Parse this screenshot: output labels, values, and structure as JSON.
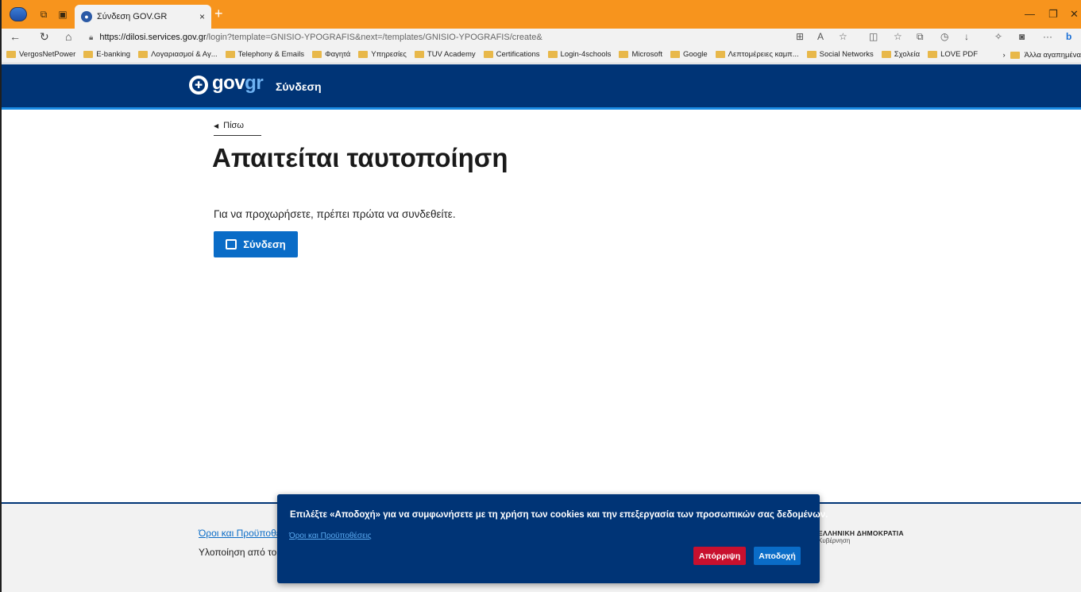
{
  "browser": {
    "tab_title": "Σύνδεση GOV.GR",
    "tab_close": "×",
    "new_tab": "+",
    "url_host": "https://dilosi.services.gov.gr",
    "url_path": "/login?template=GNISIO-YPOGRAFIS&next=/templates/GNISIO-YPOGRAFIS/create&",
    "bookmarks": [
      "VergosNetPower",
      "E-banking",
      "Λογαριασμοί & Αγ...",
      "Telephony & Emails",
      "Φαγητά",
      "Υπηρεσίες",
      "TUV Academy",
      "Certifications",
      "Login-4schools",
      "Microsoft",
      "Google",
      "Λεπτομέρειες καμπ...",
      "Social Networks",
      "Σχολεία",
      "LOVE PDF"
    ],
    "other_bookmarks": "Άλλα αγαπημένα"
  },
  "header": {
    "logo_gov": "gov",
    "logo_gr": "gr",
    "service_name": "Σύνδεση"
  },
  "main": {
    "back_label": "Πίσω",
    "title": "Απαιτείται ταυτοποίηση",
    "description": "Για να προχωρήσετε, πρέπει πρώτα να συνδεθείτε.",
    "login_label": "Σύνδεση"
  },
  "footer": {
    "terms_link": "Όροι και Προϋποθέσεις",
    "implementation": "Υλοποίηση από το",
    "gov_name": "ΕΛΛΗΝΙΚΗ ΔΗΜΟΚΡΑΤΙΑ",
    "gov_sub": "Κυβέρνηση"
  },
  "cookie": {
    "text": "Επιλέξτε «Αποδοχή» για να συμφωνήσετε με τη χρήση των cookies και την επεξεργασία των προσωπικών σας δεδομένων.",
    "terms_link": "Όροι και Προϋποθέσεις",
    "reject_label": "Απόρριψη",
    "accept_label": "Αποδοχή"
  },
  "colors": {
    "gov_blue": "#003476",
    "accent_blue": "#0a6cc7",
    "reject_red": "#c8102e",
    "titlebar_orange": "#f7941d"
  }
}
